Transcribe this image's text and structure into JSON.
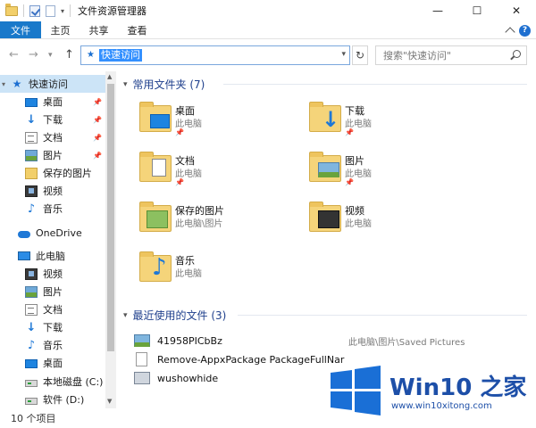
{
  "window": {
    "title": "文件资源管理器",
    "controls": {
      "minimize": "—",
      "maximize": "☐",
      "close": "✕"
    }
  },
  "ribbon": {
    "tabs": [
      "文件",
      "主页",
      "共享",
      "查看"
    ],
    "help": "?"
  },
  "address": {
    "path": "快速访问",
    "search_placeholder": "搜索\"快速访问\""
  },
  "nav": {
    "items": [
      {
        "label": "快速访问",
        "icon": "star-icon",
        "selected": true
      },
      {
        "label": "桌面",
        "icon": "desktop-icon",
        "pinned": true
      },
      {
        "label": "下载",
        "icon": "download-icon",
        "pinned": true
      },
      {
        "label": "文档",
        "icon": "document-icon",
        "pinned": true
      },
      {
        "label": "图片",
        "icon": "picture-icon",
        "pinned": true
      },
      {
        "label": "保存的图片",
        "icon": "folder-icon"
      },
      {
        "label": "视频",
        "icon": "video-icon"
      },
      {
        "label": "音乐",
        "icon": "music-icon"
      },
      {
        "label": "OneDrive",
        "icon": "onedrive-icon"
      },
      {
        "label": "此电脑",
        "icon": "computer-icon"
      },
      {
        "label": "视频",
        "icon": "video-icon"
      },
      {
        "label": "图片",
        "icon": "picture-icon"
      },
      {
        "label": "文档",
        "icon": "document-icon"
      },
      {
        "label": "下载",
        "icon": "download-icon"
      },
      {
        "label": "音乐",
        "icon": "music-icon"
      },
      {
        "label": "桌面",
        "icon": "desktop-icon"
      },
      {
        "label": "本地磁盘 (C:)",
        "icon": "drive-icon"
      },
      {
        "label": "软件 (D:)",
        "icon": "drive-icon"
      }
    ]
  },
  "frequent": {
    "header": "常用文件夹 (7)",
    "items": [
      {
        "name": "桌面",
        "sub": "此电脑",
        "pinned": true
      },
      {
        "name": "下载",
        "sub": "此电脑",
        "pinned": true
      },
      {
        "name": "文档",
        "sub": "此电脑",
        "pinned": true
      },
      {
        "name": "图片",
        "sub": "此电脑",
        "pinned": true
      },
      {
        "name": "保存的图片",
        "sub": "此电脑\\图片",
        "pinned": false
      },
      {
        "name": "视频",
        "sub": "此电脑",
        "pinned": false
      },
      {
        "name": "音乐",
        "sub": "此电脑",
        "pinned": false
      }
    ]
  },
  "recent": {
    "header": "最近使用的文件 (3)",
    "items": [
      {
        "name": "41958PICbBz",
        "path": "此电脑\\图片\\Saved Pictures"
      },
      {
        "name": "Remove-AppxPackage PackageFullNar",
        "path": ""
      },
      {
        "name": "wushowhide",
        "path": ""
      }
    ]
  },
  "status": {
    "count": "10 个项目"
  },
  "watermark": {
    "title": "Win10 之家",
    "url": "www.win10xitong.com"
  },
  "colors": {
    "accent": "#1979ca",
    "header_text": "#1e3f8c",
    "selection": "#cce4f7"
  }
}
